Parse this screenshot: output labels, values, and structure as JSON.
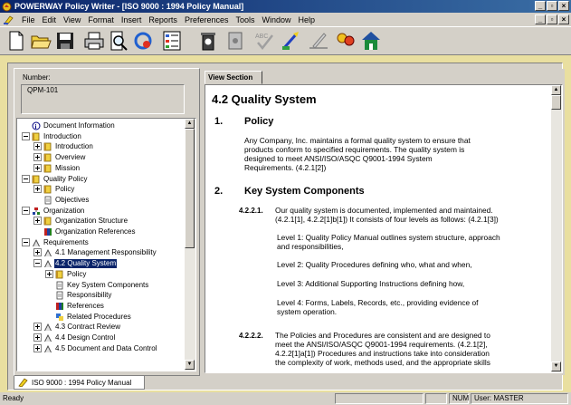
{
  "window": {
    "title": "POWERWAY Policy Writer - [ISO 9000 : 1994 Policy Manual]",
    "minimize": "_",
    "restore": "▫",
    "close": "×"
  },
  "menu": [
    "File",
    "Edit",
    "View",
    "Format",
    "Insert",
    "Reports",
    "Preferences",
    "Tools",
    "Window",
    "Help"
  ],
  "toolbar": [
    "new-document-icon",
    "open-folder-icon",
    "save-disk-icon",
    "print-icon",
    "print-preview-icon",
    "refresh-icon",
    "outline-list-icon",
    "trash-icon",
    "document-icon",
    "spellcheck-icon",
    "wizard-icon",
    "sign-icon",
    "users-icon",
    "home-icon"
  ],
  "left": {
    "number_label": "Number:",
    "number_value": "QPM-101",
    "tree": [
      {
        "label": "Document Information",
        "level": 0,
        "icon": "info",
        "expander": ""
      },
      {
        "label": "Introduction",
        "level": 0,
        "icon": "book",
        "expander": "-"
      },
      {
        "label": "Introduction",
        "level": 1,
        "icon": "book",
        "expander": "+"
      },
      {
        "label": "Overview",
        "level": 1,
        "icon": "book",
        "expander": "+"
      },
      {
        "label": "Mission",
        "level": 1,
        "icon": "book",
        "expander": "+"
      },
      {
        "label": "Quality Policy",
        "level": 0,
        "icon": "book",
        "expander": "-"
      },
      {
        "label": "Policy",
        "level": 1,
        "icon": "book",
        "expander": "+"
      },
      {
        "label": "Objectives",
        "level": 1,
        "icon": "page",
        "expander": ""
      },
      {
        "label": "Organization",
        "level": 0,
        "icon": "org",
        "expander": "-"
      },
      {
        "label": "Organization Structure",
        "level": 1,
        "icon": "book",
        "expander": "+"
      },
      {
        "label": "Organization References",
        "level": 1,
        "icon": "refs",
        "expander": ""
      },
      {
        "label": "Requirements",
        "level": 0,
        "icon": "req",
        "expander": "-"
      },
      {
        "label": "4.1 Management Responsibility",
        "level": 1,
        "icon": "req",
        "expander": "+"
      },
      {
        "label": "4.2 Quality System",
        "level": 1,
        "icon": "req",
        "expander": "-",
        "selected": true
      },
      {
        "label": "Policy",
        "level": 2,
        "icon": "book",
        "expander": "+"
      },
      {
        "label": "Key System Components",
        "level": 2,
        "icon": "page",
        "expander": ""
      },
      {
        "label": "Responsibility",
        "level": 2,
        "icon": "page",
        "expander": ""
      },
      {
        "label": "References",
        "level": 2,
        "icon": "refs",
        "expander": ""
      },
      {
        "label": "Related Procedures",
        "level": 2,
        "icon": "proc",
        "expander": ""
      },
      {
        "label": "4.3 Contract Review",
        "level": 1,
        "icon": "req",
        "expander": "+"
      },
      {
        "label": "4.4 Design Control",
        "level": 1,
        "icon": "req",
        "expander": "+"
      },
      {
        "label": "4.5 Document and Data Control",
        "level": 1,
        "icon": "req",
        "expander": "+"
      }
    ]
  },
  "right": {
    "tab_label": "View Section",
    "heading": "4.2 Quality System",
    "sections": [
      {
        "num": "1.",
        "title": "Policy"
      },
      {
        "num": "2.",
        "title": "Key System Components"
      }
    ],
    "policy_text": [
      "Any Company, Inc. maintains a formal quality system to ensure that",
      "products conform to specified requirements. The quality system is",
      "designed to meet ANSI/ISO/ASQC Q9001-1994 System",
      "Requirements. (4.2.1[2])"
    ],
    "p1_num": "4.2.2.1.",
    "p1_text": [
      "Our quality system is documented, implemented and maintained.",
      "(4.2.1[1], 4.2.2[1]b[1]) It consists of four levels as follows: (4.2.1[3])"
    ],
    "levels": [
      [
        "Level 1: Quality Policy Manual outlines system structure, approach",
        "and responsibilities,"
      ],
      [
        "Level 2: Quality Procedures defining who, what and when,"
      ],
      [
        "Level 3: Additional Supporting Instructions defining how,"
      ],
      [
        "Level 4: Forms, Labels, Records, etc., providing evidence of",
        "system operation."
      ]
    ],
    "p2_num": "4.2.2.2.",
    "p2_text": [
      "The Policies and Procedures are consistent and are designed to",
      "meet the ANSI/ISO/ASQC Q9001-1994 requirements. (4.2.1[2],",
      "4.2.2[1]a[1]) Procedures and instructions take into consideration",
      "the complexity of work, methods used, and the appropriate skills"
    ]
  },
  "bottom_tab": "ISO 9000 : 1994 Policy Manual",
  "status": {
    "text": "Ready",
    "num": "NUM",
    "user": "User: MASTER"
  },
  "colors": {
    "selection": "#0a246a",
    "desktop": "#e9dfa0",
    "face": "#d4d0c8"
  }
}
